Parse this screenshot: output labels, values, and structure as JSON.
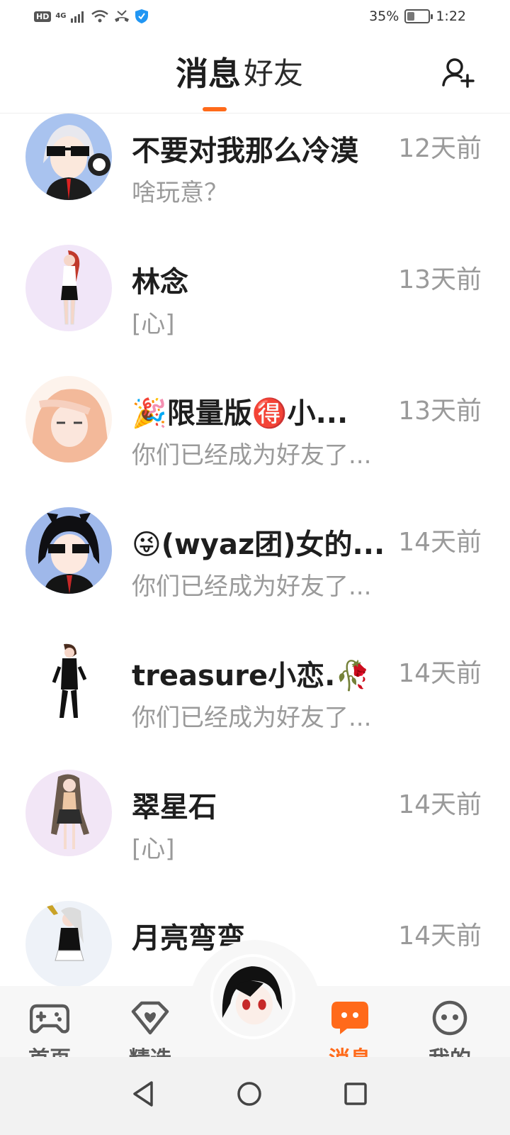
{
  "status_bar": {
    "hd": "HD",
    "network": "4G",
    "battery": "35%",
    "battery_level": 0.35,
    "time": "1:22"
  },
  "header": {
    "tab_messages": "消息",
    "tab_friends": "好友",
    "add_friend_icon": "add-user-icon"
  },
  "messages": [
    {
      "name": "不要对我那么冷漠",
      "time": "12天前",
      "preview": "啥玩意？"
    },
    {
      "name": "林念",
      "time": "13天前",
      "preview": "[心]"
    },
    {
      "name": "🎉限量版🉐小...",
      "time": "13天前",
      "preview": "你们已经成为好友了..."
    },
    {
      "name": "😜(wyaz团)女的...",
      "time": "14天前",
      "preview": "你们已经成为好友了..."
    },
    {
      "name": "treasure小恋.🥀",
      "time": "14天前",
      "preview": "你们已经成为好友了..."
    },
    {
      "name": "翠星石",
      "time": "14天前",
      "preview": "[心]"
    },
    {
      "name": "月亮弯弯",
      "time": "14天前",
      "preview": ""
    }
  ],
  "bottom_nav": {
    "home": "首页",
    "featured": "精选",
    "messages": "消息",
    "mine": "我的"
  },
  "colors": {
    "accent": "#ff6a1a",
    "muted_text": "#9a9a9a"
  }
}
